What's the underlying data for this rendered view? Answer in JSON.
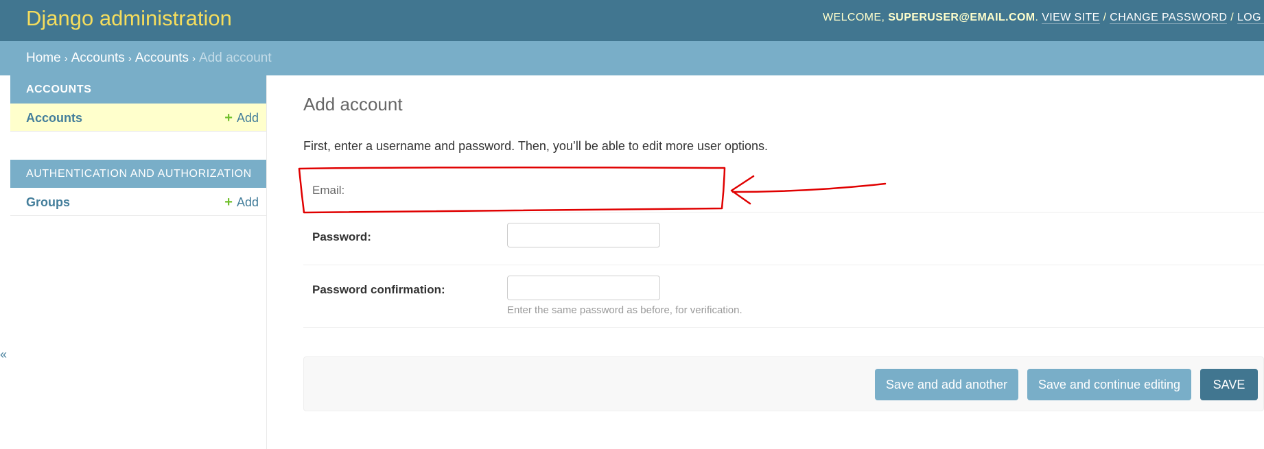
{
  "header": {
    "site_name": "Django administration",
    "welcome": "Welcome,",
    "username": "superuser@email.com",
    "view_site": "View site",
    "change_password": "Change password",
    "logout": "Log out",
    "separator": "/"
  },
  "breadcrumbs": {
    "items": [
      "Home",
      "Accounts",
      "Accounts"
    ],
    "current": "Add account",
    "arrow": "›"
  },
  "sidebar": {
    "toggle": "«",
    "modules": [
      {
        "caption": "Accounts",
        "models": [
          {
            "name": "Accounts",
            "add_label": "Add"
          }
        ]
      },
      {
        "caption": "Authentication and Authorization",
        "models": [
          {
            "name": "Groups",
            "add_label": "Add"
          }
        ]
      }
    ]
  },
  "content": {
    "title": "Add account",
    "intro": "First, enter a username and password. Then, you’ll be able to edit more user options.",
    "fields": [
      {
        "label": "Email:",
        "value": ""
      },
      {
        "label": "Password:",
        "value": ""
      },
      {
        "label": "Password confirmation:",
        "value": "",
        "help": "Enter the same password as before, for verification."
      }
    ]
  },
  "submit": {
    "save_add_another": "Save and add another",
    "save_continue": "Save and continue editing",
    "save": "Save"
  },
  "colors": {
    "header_bg": "#417690",
    "breadcrumb_bg": "#79aec8",
    "brand_yellow": "#f5dd5d",
    "link_blue": "#447e9b",
    "add_green": "#70bf2b",
    "current_row": "#ffffcc",
    "annotation_red": "#e00000"
  },
  "icons": {
    "add": "plus-icon",
    "annotation": "red-arrow-annotation"
  }
}
